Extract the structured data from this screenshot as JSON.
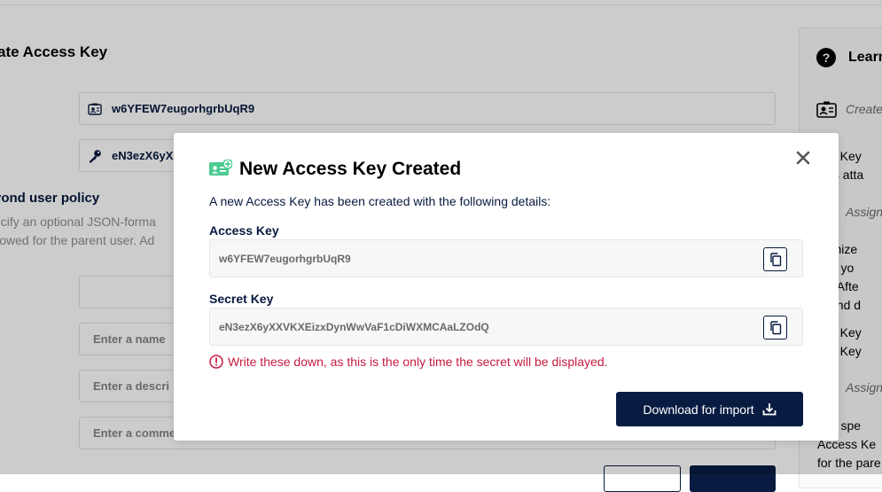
{
  "background": {
    "title": "ate Access Key",
    "access_key_value": "w6YFEW7eugorhgrbUqR9",
    "secret_key_value": "eN3ezX6yX",
    "policy_title": "yond user policy",
    "policy_desc_line1": "ecify an optional JSON-forma",
    "policy_desc_line2": "llowed for the parent user. Ad",
    "name_placeholder": "Enter a name",
    "description_placeholder": "Enter a descri",
    "comments_placeholder": "Enter a comme",
    "panel": {
      "title": "Learn",
      "items": [
        "Create",
        "ess Key",
        "cies atta",
        "Assign",
        "domize",
        "use yo",
        "es. Afte",
        "w and d",
        "ess Key",
        "ess Key",
        "Assign",
        "can spe",
        "Access Ke",
        "for the pare"
      ]
    }
  },
  "modal": {
    "title": "New Access Key Created",
    "intro": "A new Access Key has been created with the following details:",
    "access_key_label": "Access Key",
    "access_key": "w6YFEW7eugorhgrbUqR9",
    "secret_key_label": "Secret Key",
    "secret_key": "eN3ezX6yXXVKXEizxDynWwVaF1cDiWXMCAaLZOdQ",
    "warning": "Write these down, as this is the only time the secret will be displayed.",
    "download_label": "Download for import"
  },
  "colors": {
    "primary": "#081c42",
    "warning": "#c51b3f",
    "accent_green": "#4ccb92"
  }
}
